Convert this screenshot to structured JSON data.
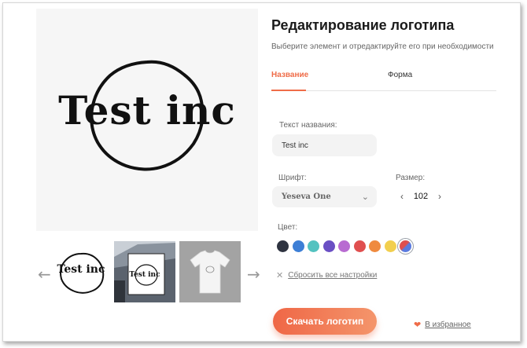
{
  "preview": {
    "logo_text": "Test inc"
  },
  "gallery": {
    "thumbs": [
      {
        "logo_text": "Test inc"
      },
      {
        "logo_text": "Test inc"
      }
    ]
  },
  "panel": {
    "title": "Редактирование логотипа",
    "subtitle": "Выберите элемент и отредактируйте его при необходимости",
    "tabs": [
      {
        "label": "Название"
      },
      {
        "label": "Форма"
      }
    ],
    "name_label": "Текст названия:",
    "name_value": "Test inc",
    "font_label": "Шрифт:",
    "font_value": "Yeseva One",
    "size_label": "Размер:",
    "size_value": "102",
    "color_label": "Цвет:",
    "colors": [
      "#2e3340",
      "#3d7fd6",
      "#53c2c0",
      "#6a4fc4",
      "#b86bd1",
      "#e04f4f",
      "#ef8a3f",
      "#f2cf4e",
      "#5a7be0"
    ],
    "selected_color_index": 8,
    "reset_label": "Сбросить все настройки",
    "download_label": "Скачать логотип",
    "favorite_label": "В избранное",
    "accent_color": "#ef6c48"
  }
}
